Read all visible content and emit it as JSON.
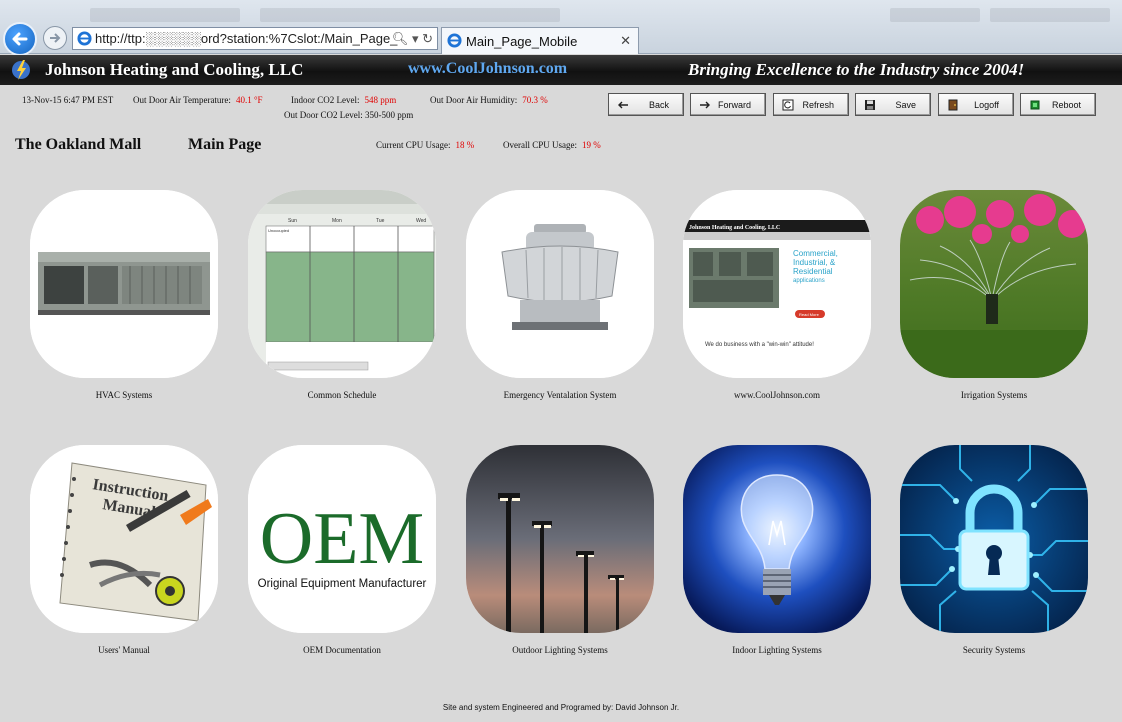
{
  "browser": {
    "address": "http://ttp:░░░░░░ord?station:%7Cslot:/Main_Page_",
    "tab_title": "Main_Page_Mobile",
    "tab_close": "✕"
  },
  "banner": {
    "company": "Johnson Heating and Cooling, LLC",
    "website": "www.CoolJohnson.com",
    "slogan": "Bringing Excellence to the Industry since 2004!"
  },
  "status": {
    "datetime": "13-Nov-15 6:47 PM EST",
    "outdoor_temp_label": "Out Door Air Temperature:",
    "outdoor_temp_value": "40.1 °F",
    "indoor_co2_label": "Indoor CO2 Level:",
    "indoor_co2_value": "548 ppm",
    "humidity_label": "Out Door Air Humidity:",
    "humidity_value": "70.3 %",
    "outdoor_co2": "Out Door CO2 Level: 350-500 ppm"
  },
  "toolbar": {
    "back": "Back",
    "forward": "Forward",
    "refresh": "Refresh",
    "save": "Save",
    "logoff": "Logoff",
    "reboot": "Reboot"
  },
  "location": {
    "site": "The Oakland Mall",
    "page": "Main Page",
    "current_cpu_label": "Current CPU Usage:",
    "current_cpu_value": "18 %",
    "overall_cpu_label": "Overall CPU Usage:",
    "overall_cpu_value": "19 %"
  },
  "tiles": [
    {
      "label": "HVAC Systems",
      "icon": "hvac-unit-icon"
    },
    {
      "label": "Common Schedule",
      "icon": "schedule-icon"
    },
    {
      "label": "Emergency Ventalation System",
      "icon": "exhaust-fan-icon"
    },
    {
      "label": "www.CoolJohnson.com",
      "icon": "website-icon"
    },
    {
      "label": "Irrigation Systems",
      "icon": "sprinkler-icon"
    },
    {
      "label": "Users' Manual",
      "icon": "manual-icon"
    },
    {
      "label": "OEM Documentation",
      "icon": "oem-icon"
    },
    {
      "label": "Outdoor Lighting Systems",
      "icon": "street-light-icon"
    },
    {
      "label": "Indoor Lighting Systems",
      "icon": "light-bulb-icon"
    },
    {
      "label": "Security Systems",
      "icon": "padlock-icon"
    }
  ],
  "tile_text": {
    "schedule_headers": [
      "Sun",
      "Mon",
      "Tue",
      "Wed"
    ],
    "schedule_cell": "Unoccupied",
    "website_title": "Johnson Heating and Cooling, LLC",
    "website_heading1": "Commercial,",
    "website_heading2": "Industrial, &",
    "website_heading3": "Residential",
    "website_heading4": "applications",
    "website_button": "Read More",
    "website_tagline": "We do business with a \"win-win\" attitude!",
    "manual_line1": "Instruction",
    "manual_line2": "Manual",
    "oem_big": "OEM",
    "oem_small": "Original Equipment Manufacturer"
  },
  "footer": "Site and system Engineered and Programed by: David Johnson Jr.",
  "colors": {
    "accent_red": "#e00000",
    "website_blue": "#5fa8f0",
    "oem_green": "#1b6b2a"
  }
}
